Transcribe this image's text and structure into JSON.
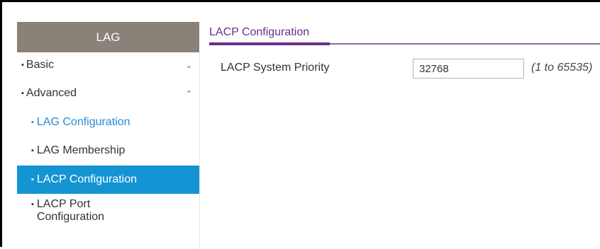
{
  "sidebar": {
    "header": "LAG",
    "sections": [
      {
        "label": "Basic",
        "chevron": "chevron-down-icon"
      },
      {
        "label": "Advanced",
        "chevron": "chevron-up-icon"
      }
    ],
    "items": [
      {
        "label": "LAG Configuration"
      },
      {
        "label": "LAG Membership"
      },
      {
        "label": "LACP Configuration"
      },
      {
        "label": "LACP Port\nConfiguration"
      }
    ]
  },
  "main": {
    "tab_title": "LACP Configuration",
    "fields": [
      {
        "label": "LACP System Priority",
        "value": "32768",
        "range": "(1 to 65535)"
      }
    ]
  },
  "colors": {
    "sidebar_header_bg": "#8a8179",
    "active_item_bg": "#1594d3",
    "link": "#2a8ad4",
    "tab_accent": "#6a2e8e"
  }
}
